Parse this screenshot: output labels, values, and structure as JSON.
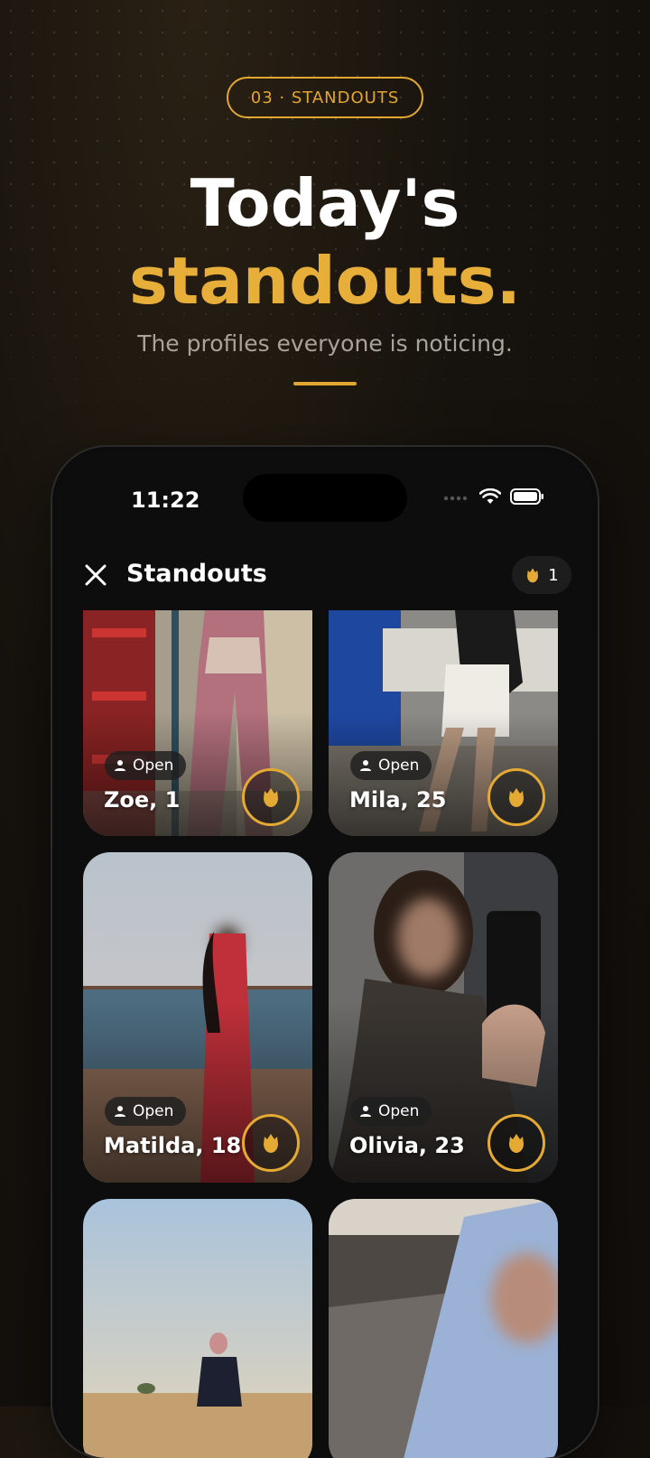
{
  "promo": {
    "badge": "03 · STANDOUTS",
    "title_line1": "Today's",
    "title_line2": "standouts.",
    "subtitle": "The profiles everyone is noticing.",
    "accent_color": "#e3a631"
  },
  "status_bar": {
    "time": "11:22",
    "icons": [
      "cellular-icon",
      "wifi-icon",
      "battery-icon"
    ]
  },
  "header": {
    "title": "Standouts",
    "rose_count": "1",
    "close_icon": "close-icon",
    "rose_icon": "rose-icon"
  },
  "cards": [
    {
      "name": "Zoe, 1",
      "badge": "Open"
    },
    {
      "name": "Mila, 25",
      "badge": "Open"
    },
    {
      "name": "Matilda, 18",
      "badge": "Open"
    },
    {
      "name": "Olivia, 23",
      "badge": "Open"
    },
    {
      "name": "",
      "badge": ""
    },
    {
      "name": "",
      "badge": ""
    }
  ]
}
